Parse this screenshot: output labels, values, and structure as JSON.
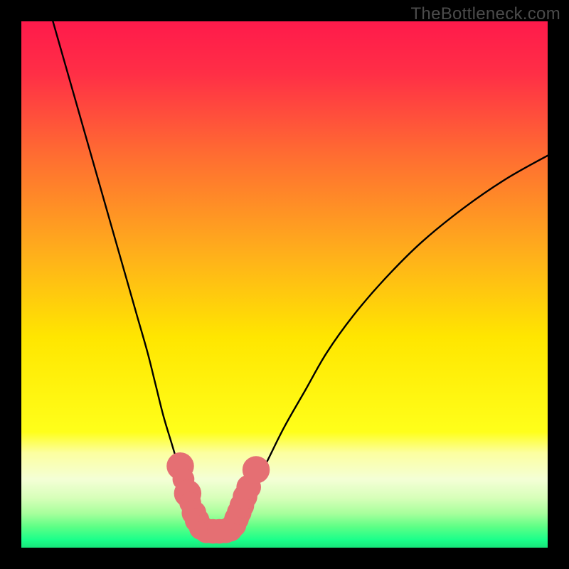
{
  "watermark": "TheBottleneck.com",
  "chart_data": {
    "type": "line",
    "title": "",
    "xlabel": "",
    "ylabel": "",
    "xlim": [
      0,
      100
    ],
    "ylim": [
      0,
      100
    ],
    "grid": false,
    "legend": false,
    "background_gradient": {
      "stops": [
        {
          "pos": 0.0,
          "color": "#ff1a4b"
        },
        {
          "pos": 0.1,
          "color": "#ff2f46"
        },
        {
          "pos": 0.25,
          "color": "#ff6b32"
        },
        {
          "pos": 0.45,
          "color": "#ffb21a"
        },
        {
          "pos": 0.6,
          "color": "#ffe600"
        },
        {
          "pos": 0.78,
          "color": "#ffff1a"
        },
        {
          "pos": 0.82,
          "color": "#fcffa0"
        },
        {
          "pos": 0.87,
          "color": "#f4ffd6"
        },
        {
          "pos": 0.905,
          "color": "#d8ffba"
        },
        {
          "pos": 0.935,
          "color": "#a7ff9c"
        },
        {
          "pos": 0.96,
          "color": "#5eff86"
        },
        {
          "pos": 0.985,
          "color": "#1bff8a"
        },
        {
          "pos": 1.0,
          "color": "#17e57a"
        }
      ]
    },
    "series": [
      {
        "name": "left-branch",
        "x": [
          6,
          8,
          10,
          12,
          14,
          16,
          18,
          20,
          22,
          24,
          25.5,
          27,
          28.5,
          30,
          31.2,
          32.3,
          33.3,
          34,
          34.8
        ],
        "y": [
          100,
          93,
          86,
          79,
          72,
          65,
          58,
          51,
          44,
          37,
          31,
          25,
          20,
          15,
          11,
          8,
          5.5,
          4,
          3
        ]
      },
      {
        "name": "right-branch",
        "x": [
          40.2,
          41,
          42,
          43.5,
          45,
          47,
          50,
          54,
          58,
          63,
          69,
          76,
          84,
          92,
          100
        ],
        "y": [
          3,
          4.5,
          7,
          10,
          13,
          17,
          23,
          30,
          37,
          44,
          51,
          58,
          64.5,
          70,
          74.5
        ]
      }
    ],
    "markers": {
      "color": "#e56f73",
      "points": [
        {
          "x": 30.2,
          "y": 15.5,
          "r": 2.0
        },
        {
          "x": 30.8,
          "y": 13.0,
          "r": 1.6
        },
        {
          "x": 31.6,
          "y": 10.3,
          "r": 2.0
        },
        {
          "x": 32.1,
          "y": 8.5,
          "r": 1.6
        },
        {
          "x": 32.8,
          "y": 6.6,
          "r": 1.8
        },
        {
          "x": 33.4,
          "y": 5.2,
          "r": 1.8
        },
        {
          "x": 34.2,
          "y": 3.8,
          "r": 1.8
        },
        {
          "x": 35.2,
          "y": 3.2,
          "r": 1.8
        },
        {
          "x": 36.4,
          "y": 3.1,
          "r": 1.8
        },
        {
          "x": 37.6,
          "y": 3.1,
          "r": 1.8
        },
        {
          "x": 38.8,
          "y": 3.2,
          "r": 1.8
        },
        {
          "x": 39.7,
          "y": 3.5,
          "r": 1.8
        },
        {
          "x": 40.4,
          "y": 4.3,
          "r": 1.8
        },
        {
          "x": 40.9,
          "y": 5.5,
          "r": 1.8
        },
        {
          "x": 41.4,
          "y": 6.7,
          "r": 1.8
        },
        {
          "x": 41.9,
          "y": 8.0,
          "r": 1.8
        },
        {
          "x": 42.5,
          "y": 9.7,
          "r": 1.8
        },
        {
          "x": 43.2,
          "y": 11.5,
          "r": 1.8
        },
        {
          "x": 44.6,
          "y": 14.8,
          "r": 2.0
        }
      ]
    }
  }
}
